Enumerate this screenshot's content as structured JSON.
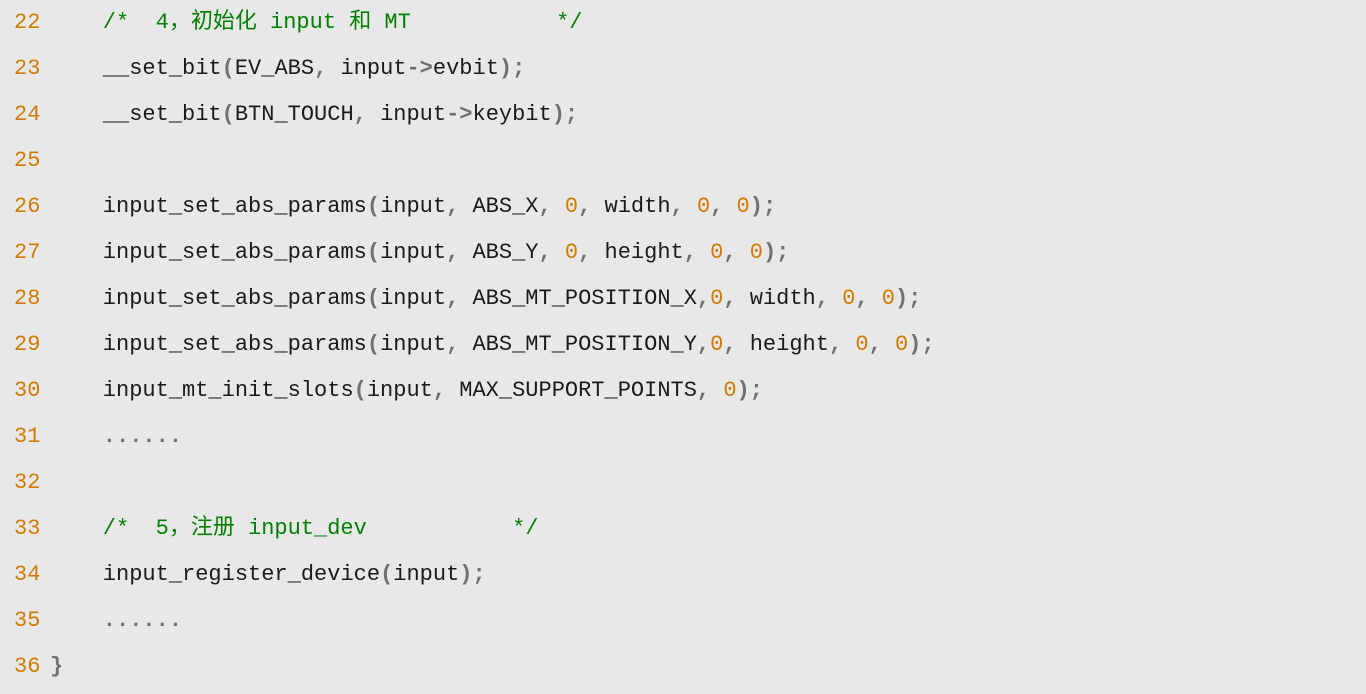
{
  "lines": [
    {
      "n": "22",
      "tokens": [
        {
          "cls": "c-comment",
          "txt": "    /*  4，初始化 input 和 MT           */"
        }
      ]
    },
    {
      "n": "23",
      "tokens": [
        {
          "cls": "c-ident",
          "txt": "    __set_bit"
        },
        {
          "cls": "c-punct",
          "txt": "("
        },
        {
          "cls": "c-ident",
          "txt": "EV_ABS"
        },
        {
          "cls": "c-punct",
          "txt": ", "
        },
        {
          "cls": "c-ident",
          "txt": "input"
        },
        {
          "cls": "c-op",
          "txt": "->"
        },
        {
          "cls": "c-ident",
          "txt": "evbit"
        },
        {
          "cls": "c-punct",
          "txt": ");"
        }
      ]
    },
    {
      "n": "24",
      "tokens": [
        {
          "cls": "c-ident",
          "txt": "    __set_bit"
        },
        {
          "cls": "c-punct",
          "txt": "("
        },
        {
          "cls": "c-ident",
          "txt": "BTN_TOUCH"
        },
        {
          "cls": "c-punct",
          "txt": ", "
        },
        {
          "cls": "c-ident",
          "txt": "input"
        },
        {
          "cls": "c-op",
          "txt": "->"
        },
        {
          "cls": "c-ident",
          "txt": "keybit"
        },
        {
          "cls": "c-punct",
          "txt": ");"
        }
      ]
    },
    {
      "n": "25",
      "tokens": [
        {
          "cls": "c-ident",
          "txt": " "
        }
      ]
    },
    {
      "n": "26",
      "tokens": [
        {
          "cls": "c-ident",
          "txt": "    input_set_abs_params"
        },
        {
          "cls": "c-punct",
          "txt": "("
        },
        {
          "cls": "c-ident",
          "txt": "input"
        },
        {
          "cls": "c-punct",
          "txt": ", "
        },
        {
          "cls": "c-ident",
          "txt": "ABS_X"
        },
        {
          "cls": "c-punct",
          "txt": ", "
        },
        {
          "cls": "c-num",
          "txt": "0"
        },
        {
          "cls": "c-punct",
          "txt": ", "
        },
        {
          "cls": "c-ident",
          "txt": "width"
        },
        {
          "cls": "c-punct",
          "txt": ", "
        },
        {
          "cls": "c-num",
          "txt": "0"
        },
        {
          "cls": "c-punct",
          "txt": ", "
        },
        {
          "cls": "c-num",
          "txt": "0"
        },
        {
          "cls": "c-punct",
          "txt": ");"
        }
      ]
    },
    {
      "n": "27",
      "tokens": [
        {
          "cls": "c-ident",
          "txt": "    input_set_abs_params"
        },
        {
          "cls": "c-punct",
          "txt": "("
        },
        {
          "cls": "c-ident",
          "txt": "input"
        },
        {
          "cls": "c-punct",
          "txt": ", "
        },
        {
          "cls": "c-ident",
          "txt": "ABS_Y"
        },
        {
          "cls": "c-punct",
          "txt": ", "
        },
        {
          "cls": "c-num",
          "txt": "0"
        },
        {
          "cls": "c-punct",
          "txt": ", "
        },
        {
          "cls": "c-ident",
          "txt": "height"
        },
        {
          "cls": "c-punct",
          "txt": ", "
        },
        {
          "cls": "c-num",
          "txt": "0"
        },
        {
          "cls": "c-punct",
          "txt": ", "
        },
        {
          "cls": "c-num",
          "txt": "0"
        },
        {
          "cls": "c-punct",
          "txt": ");"
        }
      ]
    },
    {
      "n": "28",
      "tokens": [
        {
          "cls": "c-ident",
          "txt": "    input_set_abs_params"
        },
        {
          "cls": "c-punct",
          "txt": "("
        },
        {
          "cls": "c-ident",
          "txt": "input"
        },
        {
          "cls": "c-punct",
          "txt": ", "
        },
        {
          "cls": "c-ident",
          "txt": "ABS_MT_POSITION_X"
        },
        {
          "cls": "c-punct",
          "txt": ","
        },
        {
          "cls": "c-num",
          "txt": "0"
        },
        {
          "cls": "c-punct",
          "txt": ", "
        },
        {
          "cls": "c-ident",
          "txt": "width"
        },
        {
          "cls": "c-punct",
          "txt": ", "
        },
        {
          "cls": "c-num",
          "txt": "0"
        },
        {
          "cls": "c-punct",
          "txt": ", "
        },
        {
          "cls": "c-num",
          "txt": "0"
        },
        {
          "cls": "c-punct",
          "txt": ");"
        }
      ]
    },
    {
      "n": "29",
      "tokens": [
        {
          "cls": "c-ident",
          "txt": "    input_set_abs_params"
        },
        {
          "cls": "c-punct",
          "txt": "("
        },
        {
          "cls": "c-ident",
          "txt": "input"
        },
        {
          "cls": "c-punct",
          "txt": ", "
        },
        {
          "cls": "c-ident",
          "txt": "ABS_MT_POSITION_Y"
        },
        {
          "cls": "c-punct",
          "txt": ","
        },
        {
          "cls": "c-num",
          "txt": "0"
        },
        {
          "cls": "c-punct",
          "txt": ", "
        },
        {
          "cls": "c-ident",
          "txt": "height"
        },
        {
          "cls": "c-punct",
          "txt": ", "
        },
        {
          "cls": "c-num",
          "txt": "0"
        },
        {
          "cls": "c-punct",
          "txt": ", "
        },
        {
          "cls": "c-num",
          "txt": "0"
        },
        {
          "cls": "c-punct",
          "txt": ");"
        }
      ]
    },
    {
      "n": "30",
      "tokens": [
        {
          "cls": "c-ident",
          "txt": "    input_mt_init_slots"
        },
        {
          "cls": "c-punct",
          "txt": "("
        },
        {
          "cls": "c-ident",
          "txt": "input"
        },
        {
          "cls": "c-punct",
          "txt": ", "
        },
        {
          "cls": "c-ident",
          "txt": "MAX_SUPPORT_POINTS"
        },
        {
          "cls": "c-punct",
          "txt": ", "
        },
        {
          "cls": "c-num",
          "txt": "0"
        },
        {
          "cls": "c-punct",
          "txt": ");"
        }
      ]
    },
    {
      "n": "31",
      "tokens": [
        {
          "cls": "c-dots",
          "txt": "    ......"
        }
      ]
    },
    {
      "n": "32",
      "tokens": [
        {
          "cls": "c-ident",
          "txt": " "
        }
      ]
    },
    {
      "n": "33",
      "tokens": [
        {
          "cls": "c-comment",
          "txt": "    /*  5，注册 input_dev           */"
        }
      ]
    },
    {
      "n": "34",
      "tokens": [
        {
          "cls": "c-ident",
          "txt": "    input_register_device"
        },
        {
          "cls": "c-punct",
          "txt": "("
        },
        {
          "cls": "c-ident",
          "txt": "input"
        },
        {
          "cls": "c-punct",
          "txt": ");"
        }
      ]
    },
    {
      "n": "35",
      "tokens": [
        {
          "cls": "c-dots",
          "txt": "    ......"
        }
      ]
    },
    {
      "n": "36",
      "tokens": [
        {
          "cls": "c-brace",
          "txt": "}"
        }
      ]
    }
  ]
}
